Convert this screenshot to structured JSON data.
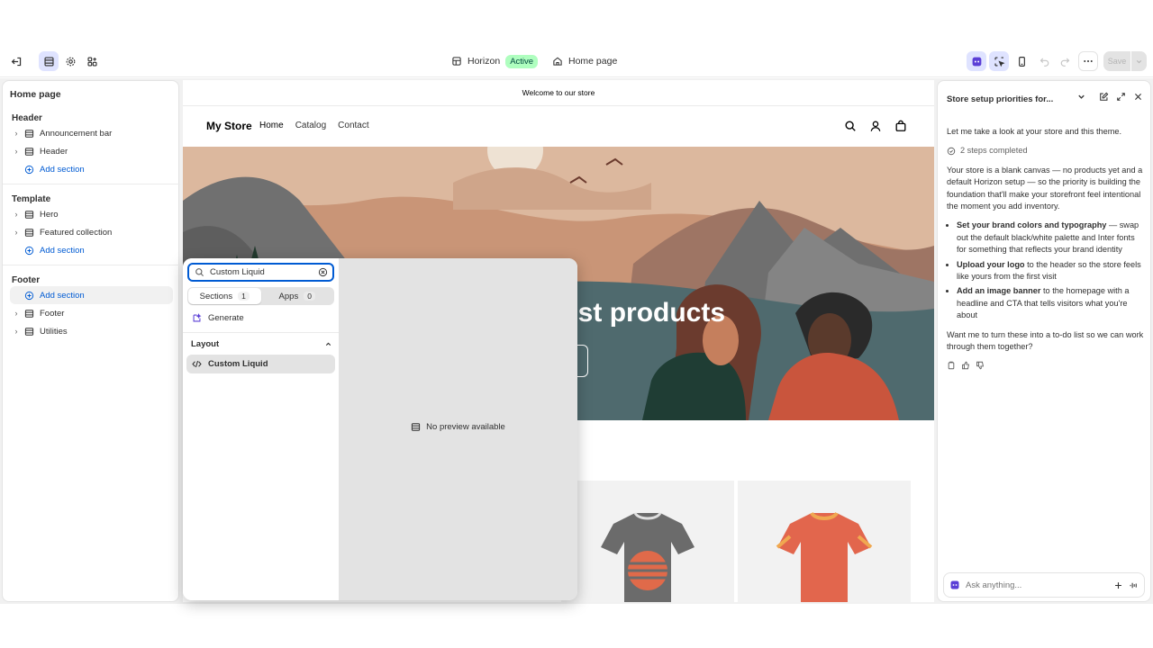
{
  "topbar": {
    "theme_name": "Horizon",
    "theme_status": "Active",
    "page_name": "Home page",
    "save_label": "Save"
  },
  "left_panel": {
    "title": "Home page",
    "groups": [
      {
        "title": "Header",
        "items": [
          "Announcement bar",
          "Header"
        ],
        "add_label": "Add section"
      },
      {
        "title": "Template",
        "items": [
          "Hero",
          "Featured collection"
        ],
        "add_label": "Add section"
      },
      {
        "title": "Footer",
        "items": [
          "Footer",
          "Utilities"
        ],
        "add_label": "Add section"
      }
    ]
  },
  "store": {
    "announcement": "Welcome to our store",
    "logo": "My Store",
    "nav": [
      "Home",
      "Catalog",
      "Contact"
    ],
    "hero_title": "est products"
  },
  "picker": {
    "search_value": "Custom Liquid",
    "tabs": [
      {
        "label": "Sections",
        "count": "1"
      },
      {
        "label": "Apps",
        "count": "0"
      }
    ],
    "generate_label": "Generate",
    "group_label": "Layout",
    "result_label": "Custom Liquid",
    "no_preview": "No preview available"
  },
  "assistant": {
    "title": "Store setup priorities for...",
    "intro": "Let me take a look at your store and this theme.",
    "steps": "2 steps completed",
    "summary": "Your store is a blank canvas — no products yet and a default Horizon setup — so the priority is building the foundation that'll make your storefront feel intentional the moment you add inventory.",
    "bullets": [
      {
        "bold": "Set your brand colors and typography",
        "rest": " — swap out the default black/white palette and Inter fonts for something that reflects your brand identity"
      },
      {
        "bold": "Upload your logo",
        "rest": " to the header so the store feels like yours from the first visit"
      },
      {
        "bold": "Add an image banner",
        "rest": " to the homepage with a headline and CTA that tells visitors what you're about"
      }
    ],
    "closing": "Want me to turn these into a to-do list so we can work through them together?",
    "ask_placeholder": "Ask anything..."
  },
  "colors": {
    "accent": "#005bd3",
    "active_badge_bg": "#affebf",
    "active_badge_fg": "#014b40"
  }
}
